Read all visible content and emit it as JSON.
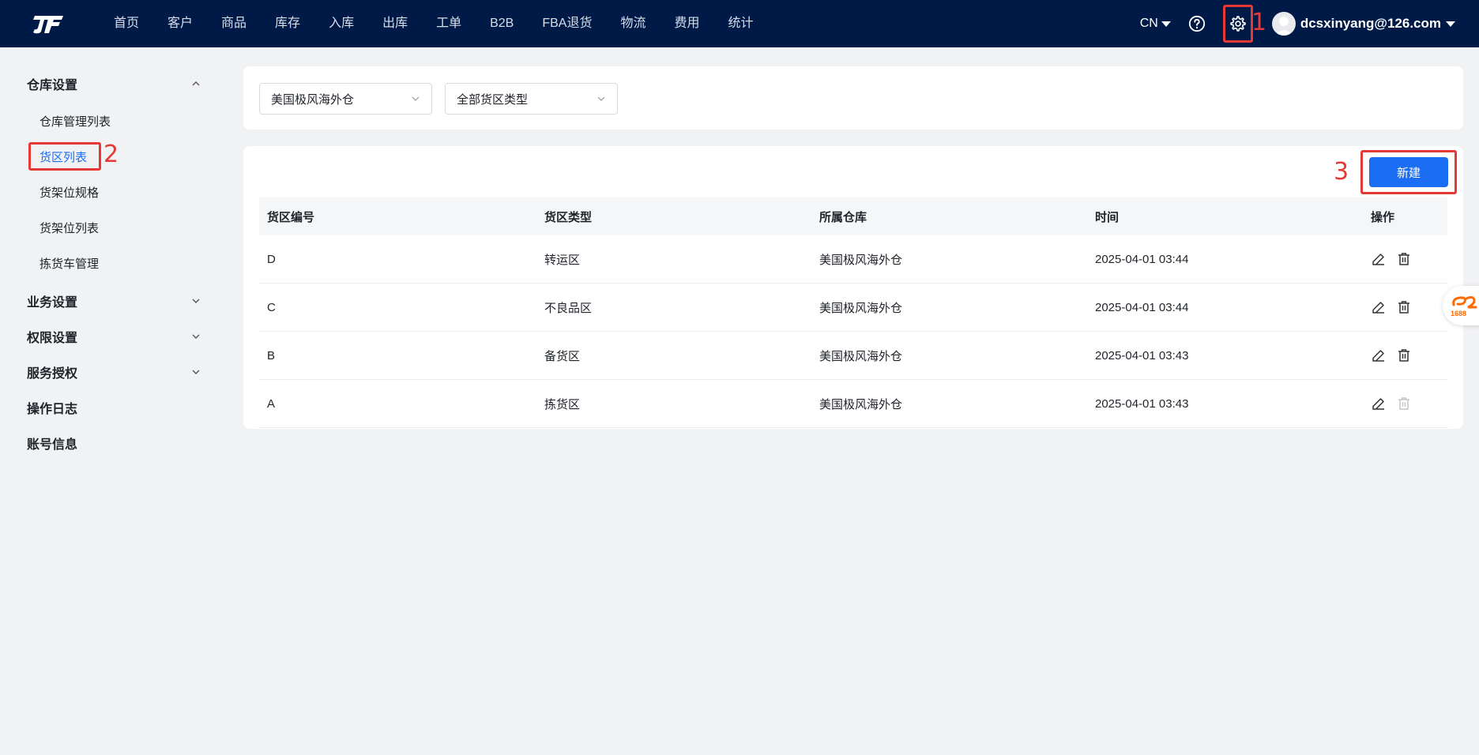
{
  "topbar": {
    "nav": [
      "首页",
      "客户",
      "商品",
      "库存",
      "入库",
      "出库",
      "工单",
      "B2B",
      "FBA退货",
      "物流",
      "费用",
      "统计"
    ],
    "lang": "CN",
    "user_email": "dcsxinyang@126.com",
    "mark_1": "1"
  },
  "sidebar": {
    "groups": [
      {
        "label": "仓库设置",
        "expanded": true
      },
      {
        "label": "业务设置"
      },
      {
        "label": "权限设置"
      },
      {
        "label": "服务授权"
      },
      {
        "label": "操作日志"
      },
      {
        "label": "账号信息"
      }
    ],
    "sub_items": [
      "仓库管理列表",
      "货区列表",
      "货架位规格",
      "货架位列表",
      "拣货车管理"
    ],
    "mark_2": "2"
  },
  "filters": {
    "warehouse": "美国极风海外仓",
    "zone_type": "全部货区类型"
  },
  "table": {
    "new_button": "新建",
    "mark_3": "3",
    "headers": [
      "货区编号",
      "货区类型",
      "所属仓库",
      "时间",
      "操作"
    ],
    "rows": [
      {
        "code": "D",
        "type": "转运区",
        "warehouse": "美国极风海外仓",
        "time": "2025-04-01 03:44",
        "delete_enabled": true
      },
      {
        "code": "C",
        "type": "不良品区",
        "warehouse": "美国极风海外仓",
        "time": "2025-04-01 03:44",
        "delete_enabled": true
      },
      {
        "code": "B",
        "type": "备货区",
        "warehouse": "美国极风海外仓",
        "time": "2025-04-01 03:43",
        "delete_enabled": true
      },
      {
        "code": "A",
        "type": "拣货区",
        "warehouse": "美国极风海外仓",
        "time": "2025-04-01 03:43",
        "delete_enabled": false
      }
    ]
  },
  "float_badge": {
    "label": "1688"
  },
  "colors": {
    "topbar": "#001a48",
    "primary": "#1b6ef3",
    "annotation": "#e53935",
    "badge": "#ff6a00"
  }
}
